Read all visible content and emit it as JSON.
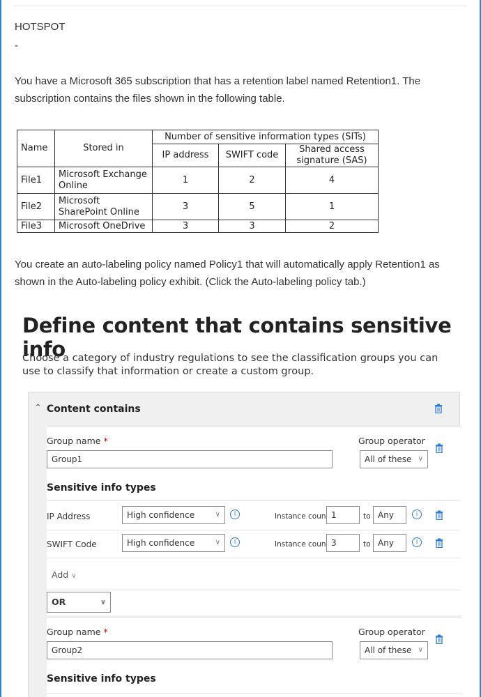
{
  "question": {
    "type_label": "HOTSPOT",
    "dash": "-",
    "paragraph1": "You have a Microsoft 365 subscription that has a retention label named Retention1. The subscription contains the files shown in the following table.",
    "paragraph2": "You create an auto-labeling policy named Policy1 that will automatically apply Retention1 as shown in the Auto-labeling policy exhibit. (Click the Auto-labeling policy tab.)"
  },
  "files_table": {
    "headers": {
      "name": "Name",
      "stored_in": "Stored in",
      "group": "Number of sensitive information types (SITs)",
      "ip": "IP address",
      "swift": "SWIFT code",
      "sas": "Shared access signature (SAS)"
    },
    "rows": [
      {
        "name": "File1",
        "stored_in": "Microsoft Exchange Online",
        "ip": "1",
        "swift": "2",
        "sas": "4"
      },
      {
        "name": "File2",
        "stored_in": "Microsoft SharePoint Online",
        "ip": "3",
        "swift": "5",
        "sas": "1"
      },
      {
        "name": "File3",
        "stored_in": "Microsoft OneDrive",
        "ip": "3",
        "swift": "3",
        "sas": "2"
      }
    ]
  },
  "exhibit": {
    "title": "Define content that contains sensitive info",
    "intro": "Choose a category of industry regulations to see the classification groups you can use to classify that information or create a custom group.",
    "section_title": "Content contains",
    "group1": {
      "name_label": "Group name",
      "required_mark": "*",
      "name_value": "Group1",
      "operator_label": "Group operator",
      "operator_value": "All of these",
      "sit_title": "Sensitive info types",
      "sits": [
        {
          "name": "IP Address",
          "confidence": "High confidence",
          "instance_label": "Instance count",
          "min": "1",
          "to": "to",
          "max": "Any"
        },
        {
          "name": "SWIFT Code",
          "confidence": "High confidence",
          "instance_label": "Instance count",
          "min": "3",
          "to": "to",
          "max": "Any"
        }
      ],
      "add_label": "Add"
    },
    "connector": "OR",
    "group2": {
      "name_label": "Group name",
      "required_mark": "*",
      "name_value": "Group2",
      "operator_label": "Group operator",
      "operator_value": "All of these",
      "sit_title": "Sensitive info types"
    }
  },
  "colors": {
    "frame": "#2b87c5",
    "accent_icon": "#2b7cd3"
  }
}
